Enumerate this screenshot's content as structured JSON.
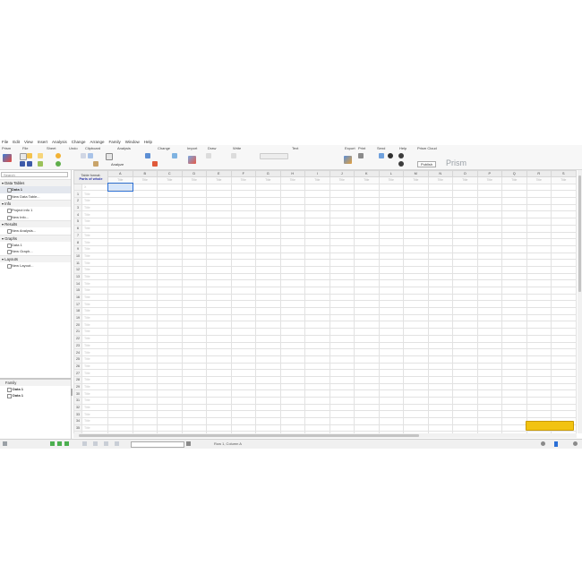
{
  "menu": [
    "File",
    "Edit",
    "View",
    "Insert",
    "Analysis",
    "Change",
    "Arrange",
    "Family",
    "Window",
    "Help"
  ],
  "ribbon_groups": [
    "Prism",
    "File",
    "Sheet",
    "Undo",
    "Clipboard",
    "Analysis",
    "Change",
    "Import",
    "Draw",
    "Write",
    "Text",
    "Export",
    "Print",
    "Send",
    "Help",
    "Prism Cloud"
  ],
  "ribbon": {
    "analyze_label": "Analyze",
    "publish_label": "Publish",
    "logo": "Prism"
  },
  "search": {
    "placeholder": "Search"
  },
  "navigator": {
    "sections": [
      {
        "label": "Data Tables",
        "items": [
          {
            "label": "Data 1",
            "selected": true
          },
          {
            "label": "New Data Table...",
            "selected": false
          }
        ]
      },
      {
        "label": "Info",
        "items": [
          {
            "label": "Project info 1",
            "selected": false
          },
          {
            "label": "New Info...",
            "selected": false
          }
        ]
      },
      {
        "label": "Results",
        "items": [
          {
            "label": "New Analysis...",
            "selected": false
          }
        ]
      },
      {
        "label": "Graphs",
        "items": [
          {
            "label": "Data 1",
            "selected": false
          },
          {
            "label": "New Graph...",
            "selected": false
          }
        ]
      },
      {
        "label": "Layouts",
        "items": [
          {
            "label": "New Layout...",
            "selected": false
          }
        ]
      }
    ]
  },
  "family": {
    "title": "Family",
    "items": [
      "Data 1",
      "Data 1"
    ]
  },
  "sheet": {
    "format_top": "Table format:",
    "format_bottom": "Parts of whole",
    "corner_x": "X",
    "columns": [
      "A",
      "B",
      "C",
      "D",
      "E",
      "F",
      "G",
      "H",
      "I",
      "J",
      "K",
      "L",
      "M",
      "N",
      "O",
      "P",
      "Q",
      "R",
      "S"
    ],
    "column_subtitle": "Title",
    "row_title": "Title",
    "row_count": 39
  },
  "status": {
    "text": "Row 1, Column A"
  },
  "colors": {
    "accent": "#2a6fd6",
    "note": "#f2c311"
  }
}
